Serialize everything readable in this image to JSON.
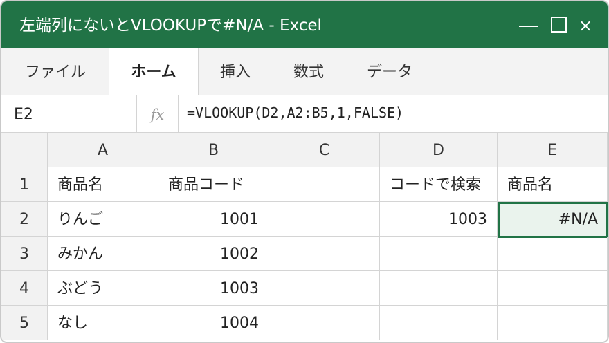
{
  "window": {
    "title": "左端列にないとVLOOKUPで#N/A - Excel",
    "accent_color": "#217346",
    "controls": {
      "minimize": "—",
      "maximize": "☐",
      "close": "×"
    }
  },
  "ribbon": {
    "tabs": [
      {
        "label": "ファイル",
        "active": false
      },
      {
        "label": "ホーム",
        "active": true
      },
      {
        "label": "挿入",
        "active": false
      },
      {
        "label": "数式",
        "active": false
      },
      {
        "label": "データ",
        "active": false
      }
    ]
  },
  "formula_bar": {
    "name_box": "E2",
    "fx_label": "fx",
    "formula": "=VLOOKUP(D2,A2:B5,1,FALSE)"
  },
  "sheet": {
    "columns": [
      "A",
      "B",
      "C",
      "D",
      "E"
    ],
    "rows": [
      {
        "num": "1",
        "cells": [
          "商品名",
          "商品コード",
          "",
          "コードで検索",
          "商品名"
        ]
      },
      {
        "num": "2",
        "cells": [
          "りんご",
          "1001",
          "",
          "1003",
          "#N/A"
        ]
      },
      {
        "num": "3",
        "cells": [
          "みかん",
          "1002",
          "",
          "",
          ""
        ]
      },
      {
        "num": "4",
        "cells": [
          "ぶどう",
          "1003",
          "",
          "",
          ""
        ]
      },
      {
        "num": "5",
        "cells": [
          "なし",
          "1004",
          "",
          "",
          ""
        ]
      }
    ],
    "selected_cell": "E2"
  }
}
